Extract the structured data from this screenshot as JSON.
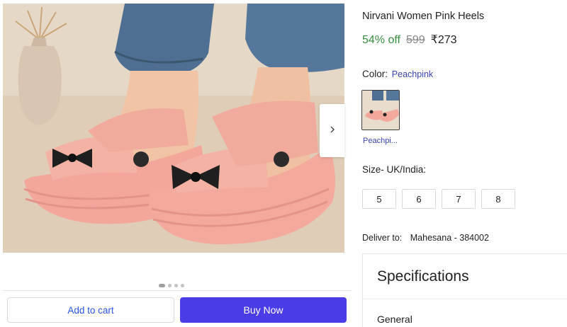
{
  "product": {
    "title": "Nirvani Women Pink Heels",
    "discount": "54% off",
    "mrp": "599",
    "price": "₹273"
  },
  "gallery": {
    "image_alt": "Pink platform sandals with black bow worn with blue jeans",
    "next_icon": "chevron-right-icon",
    "dot_count": 4,
    "active_dot": 1
  },
  "color": {
    "label": "Color:",
    "value": "Peachpink",
    "swatch_name": "Peachpi..."
  },
  "size": {
    "label": "Size- UK/India:",
    "options": [
      "5",
      "6",
      "7",
      "8"
    ]
  },
  "delivery": {
    "label": "Deliver to:",
    "location": "Mahesana - 384002"
  },
  "specifications": {
    "heading": "Specifications",
    "first_section": "General"
  },
  "actions": {
    "add_to_cart": "Add to cart",
    "buy_now": "Buy Now"
  },
  "colors": {
    "discount_green": "#388e3c",
    "buy_button": "#4a3de8",
    "link_blue": "#3a43b0",
    "cart_text": "#2a55e5"
  }
}
